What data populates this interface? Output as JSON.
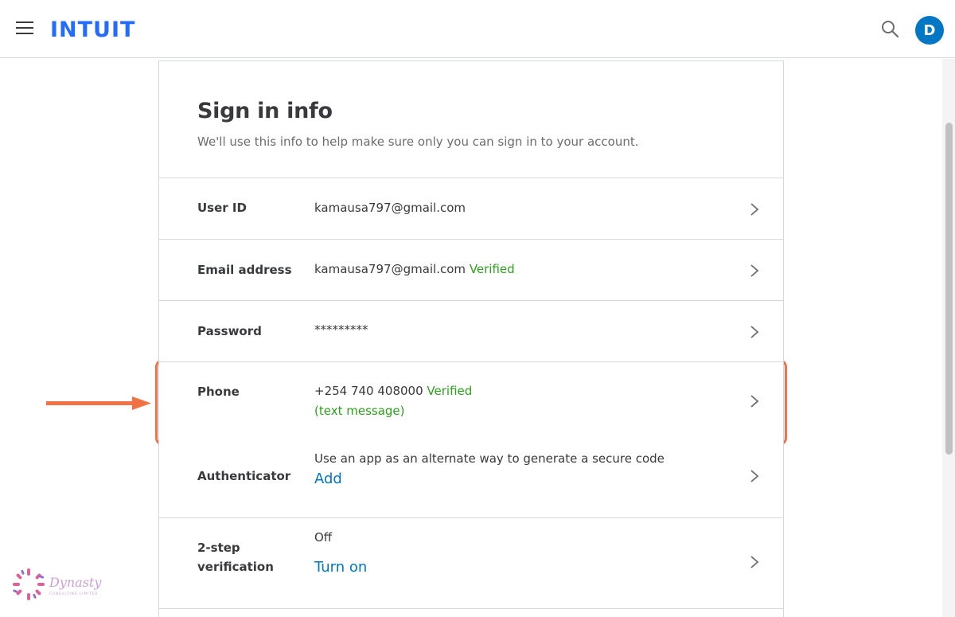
{
  "header": {
    "logo": "INTUIT",
    "avatar_initial": "D",
    "brand_color": "#236cff",
    "avatar_color": "#0077c5"
  },
  "card": {
    "title": "Sign in info",
    "subtitle": "We'll use this info to help make sure only you can sign in to your account."
  },
  "rows": {
    "user_id": {
      "label": "User ID",
      "value": "kamausa797@gmail.com"
    },
    "email": {
      "label": "Email address",
      "value": "kamausa797@gmail.com",
      "status": "Verified"
    },
    "password": {
      "label": "Password",
      "value": "*********"
    },
    "phone": {
      "label": "Phone",
      "value": "+254 740 408000",
      "status": "Verified",
      "method": "(text message)"
    },
    "authenticator": {
      "label": "Authenticator",
      "description": "Use an app as an alternate way to generate a secure code",
      "action": "Add"
    },
    "two_step": {
      "label_line1": "2-step",
      "label_line2": "verification",
      "state": "Off",
      "action": "Turn on"
    }
  },
  "watermark": {
    "text": "Dynasty",
    "subtext": "CONSULTING LIMITED"
  },
  "colors": {
    "verified": "#2ca01c",
    "link": "#0077c5",
    "highlight_border": "#f07245",
    "highlight_fill": "#e8f6fc"
  }
}
